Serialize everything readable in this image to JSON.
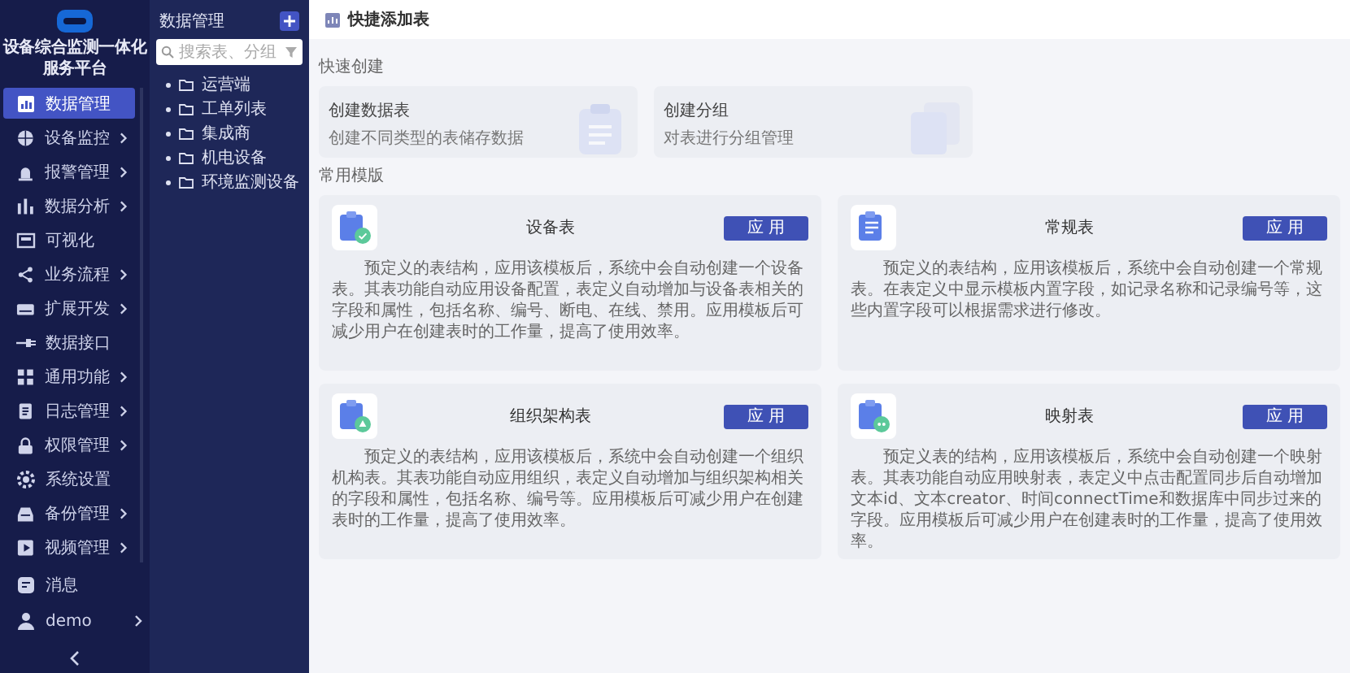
{
  "sidebar": {
    "title": "设备综合监测一体化服务平台",
    "nav": [
      {
        "label": "数据管理",
        "selected": true,
        "expandable": false
      },
      {
        "label": "设备监控",
        "selected": false,
        "expandable": true
      },
      {
        "label": "报警管理",
        "selected": false,
        "expandable": true
      },
      {
        "label": "数据分析",
        "selected": false,
        "expandable": true
      },
      {
        "label": "可视化",
        "selected": false,
        "expandable": false
      },
      {
        "label": "业务流程",
        "selected": false,
        "expandable": true
      },
      {
        "label": "扩展开发",
        "selected": false,
        "expandable": true
      },
      {
        "label": "数据接口",
        "selected": false,
        "expandable": false
      },
      {
        "label": "通用功能",
        "selected": false,
        "expandable": true
      },
      {
        "label": "日志管理",
        "selected": false,
        "expandable": true
      },
      {
        "label": "权限管理",
        "selected": false,
        "expandable": true
      },
      {
        "label": "系统设置",
        "selected": false,
        "expandable": false
      },
      {
        "label": "备份管理",
        "selected": false,
        "expandable": true
      },
      {
        "label": "视频管理",
        "selected": false,
        "expandable": true
      }
    ],
    "messages": {
      "label": "消息"
    },
    "user": {
      "label": "demo"
    }
  },
  "tree": {
    "title": "数据管理",
    "search": {
      "placeholder": "搜索表、分组"
    },
    "items": [
      {
        "label": "运营端"
      },
      {
        "label": "工单列表"
      },
      {
        "label": "集成商"
      },
      {
        "label": "机电设备"
      },
      {
        "label": "环境监测设备"
      }
    ]
  },
  "main": {
    "title": "快捷添加表",
    "quick_create": {
      "heading": "快速创建",
      "cards": [
        {
          "title": "创建数据表",
          "description": "创建不同类型的表储存数据"
        },
        {
          "title": "创建分组",
          "description": "对表进行分组管理"
        }
      ]
    },
    "templates": {
      "heading": "常用模版",
      "cards": [
        {
          "kind": "device",
          "title": "设备表",
          "button": "应用",
          "description": "预定义的表结构，应用该模板后，系统中会自动创建一个设备表。其表功能自动应用设备配置，表定义自动增加与设备表相关的字段和属性，包括名称、编号、断电、在线、禁用。应用模板后可减少用户在创建表时的工作量，提高了使用效率。"
        },
        {
          "kind": "regular",
          "title": "常规表",
          "button": "应用",
          "description": "预定义的表结构，应用该模板后，系统中会自动创建一个常规表。在表定义中显示模板内置字段，如记录名称和记录编号等，这些内置字段可以根据需求进行修改。"
        },
        {
          "kind": "org",
          "title": "组织架构表",
          "button": "应用",
          "description": "预定义的表结构，应用该模板后，系统中会自动创建一个组织机构表。其表功能自动应用组织，表定义自动增加与组织架构相关的字段和属性，包括名称、编号等。应用模板后可减少用户在创建表时的工作量，提高了使用效率。"
        },
        {
          "kind": "mapping",
          "title": "映射表",
          "button": "应用",
          "description": "预定义表的结构，应用该模板后，系统中会自动创建一个映射表。其表功能自动应用映射表，表定义中点击配置同步后自动增加文本id、文本creator、时间connectTime和数据库中同步过来的字段。应用模板后可减少用户在创建表时的工作量，提高了使用效率。"
        }
      ]
    }
  }
}
